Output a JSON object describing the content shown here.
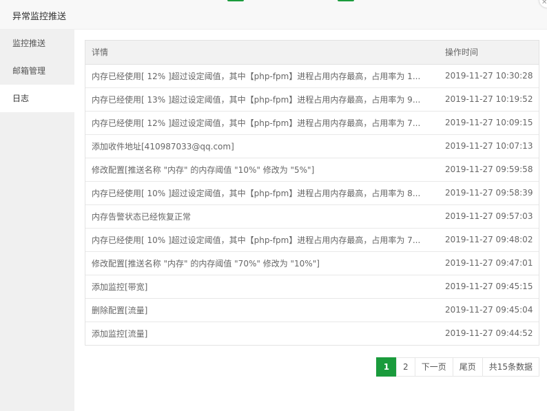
{
  "dialog": {
    "title": "异常监控推送"
  },
  "colors": {
    "accent": "#1a9b3c"
  },
  "sidebar": {
    "items": [
      {
        "label": "监控推送"
      },
      {
        "label": "邮箱管理"
      },
      {
        "label": "日志"
      }
    ],
    "active_index": 2
  },
  "table": {
    "headers": {
      "detail": "详情",
      "time": "操作时间"
    },
    "rows": [
      {
        "detail": "内存已经使用[ 12% ]超过设定阈值，其中【php-fpm】进程占用内存最高，占用率为 1...",
        "time": "2019-11-27 10:30:28"
      },
      {
        "detail": "内存已经使用[ 13% ]超过设定阈值，其中【php-fpm】进程占用内存最高，占用率为 9...",
        "time": "2019-11-27 10:19:52"
      },
      {
        "detail": "内存已经使用[ 12% ]超过设定阈值，其中【php-fpm】进程占用内存最高，占用率为 7...",
        "time": "2019-11-27 10:09:15"
      },
      {
        "detail": "添加收件地址[410987033@qq.com]",
        "time": "2019-11-27 10:07:13"
      },
      {
        "detail": "修改配置[推送名称 \"内存\" 的内存阈值 \"10%\" 修改为 \"5%\"]",
        "time": "2019-11-27 09:59:58"
      },
      {
        "detail": "内存已经使用[ 10% ]超过设定阈值，其中【php-fpm】进程占用内存最高，占用率为 8...",
        "time": "2019-11-27 09:58:39"
      },
      {
        "detail": "内存告警状态已经恢复正常",
        "time": "2019-11-27 09:57:03"
      },
      {
        "detail": "内存已经使用[ 10% ]超过设定阈值，其中【php-fpm】进程占用内存最高，占用率为 7...",
        "time": "2019-11-27 09:48:02"
      },
      {
        "detail": "修改配置[推送名称 \"内存\" 的内存阈值 \"70%\" 修改为 \"10%\"]",
        "time": "2019-11-27 09:47:01"
      },
      {
        "detail": "添加监控[带宽]",
        "time": "2019-11-27 09:45:15"
      },
      {
        "detail": "删除配置[流量]",
        "time": "2019-11-27 09:45:04"
      },
      {
        "detail": "添加监控[流量]",
        "time": "2019-11-27 09:44:52"
      }
    ]
  },
  "pagination": {
    "current": "1",
    "page2": "2",
    "next": "下一页",
    "last": "尾页",
    "total": "共15条数据"
  }
}
